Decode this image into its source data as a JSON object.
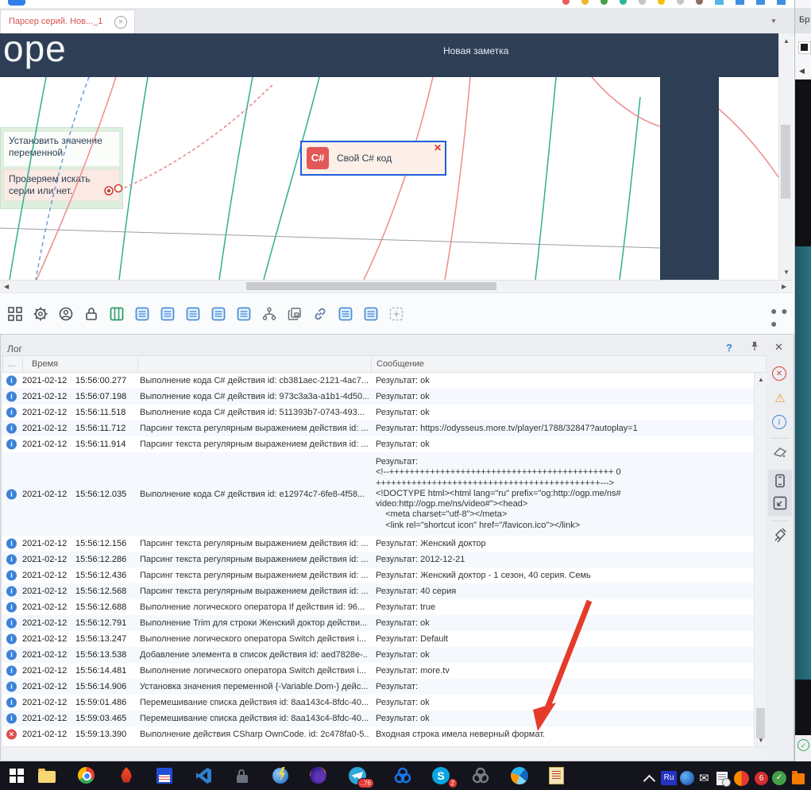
{
  "window": {
    "tab_title": "Парсер серий. Нов..._1",
    "big_text": "ope",
    "note_header": "Новая заметка",
    "side_title": "Бр",
    "toolbar_more": "..."
  },
  "blocks": {
    "set_variable": "Установить значение переменной",
    "check_series": "Проверяем искать серии или нет.",
    "cs_icon": "C#",
    "cs_label": "Свой C# код"
  },
  "log": {
    "title": "Лог",
    "help": "?",
    "col_dots": "...",
    "col_time": "Время",
    "col_message": "Сообщение",
    "rows": [
      {
        "icon": "info",
        "date": "2021-02-12",
        "time": "15:56:00.277",
        "action": "Выполнение кода C# действия id: cb381aec-2121-4ac7...",
        "message": "Результат: ok"
      },
      {
        "icon": "info",
        "date": "2021-02-12",
        "time": "15:56:07.198",
        "action": "Выполнение кода C# действия id: 973c3a3a-a1b1-4d50...",
        "message": "Результат: ok"
      },
      {
        "icon": "info",
        "date": "2021-02-12",
        "time": "15:56:11.518",
        "action": "Выполнение кода C# действия id: 511393b7-0743-493...",
        "message": "Результат: ok"
      },
      {
        "icon": "info",
        "date": "2021-02-12",
        "time": "15:56:11.712",
        "action": "Парсинг текста регулярным выражением действия id: ...",
        "message": "Результат: https://odysseus.more.tv/player/1788/32847?autoplay=1"
      },
      {
        "icon": "info",
        "date": "2021-02-12",
        "time": "15:56:11.914",
        "action": "Парсинг текста регулярным выражением действия id: ...",
        "message": "Результат: ok"
      },
      {
        "icon": "info",
        "date": "2021-02-12",
        "time": "15:56:12.035",
        "action": "Выполнение кода C# действия id: e12974c7-6fe8-4f58...",
        "message": "Результат:\n<!--++++++++++++++++++++++++++++++++++++++++++++ 0\n++++++++++++++++++++++++++++++++++++++++++++--->\n<!DOCTYPE html><html lang=\"ru\" prefix=\"og:http://ogp.me/ns#\nvideo:http://ogp.me/ns/video#\"><head>\n    <meta charset=\"utf-8\"></meta>\n    <link rel=\"shortcut icon\" href=\"/favicon.ico\"></link>"
      },
      {
        "icon": "info",
        "date": "2021-02-12",
        "time": "15:56:12.156",
        "action": "Парсинг текста регулярным выражением действия id: ...",
        "message": "Результат: Женский доктор"
      },
      {
        "icon": "info",
        "date": "2021-02-12",
        "time": "15:56:12.286",
        "action": "Парсинг текста регулярным выражением действия id: ...",
        "message": "Результат: 2012-12-21"
      },
      {
        "icon": "info",
        "date": "2021-02-12",
        "time": "15:56:12.436",
        "action": "Парсинг текста регулярным выражением действия id: ...",
        "message": "Результат: Женский доктор - 1 сезон, 40 серия. Семь"
      },
      {
        "icon": "info",
        "date": "2021-02-12",
        "time": "15:56:12.568",
        "action": "Парсинг текста регулярным выражением действия id: ...",
        "message": "Результат: 40 серия"
      },
      {
        "icon": "info",
        "date": "2021-02-12",
        "time": "15:56:12.688",
        "action": "Выполнение логического оператора If действия id: 96...",
        "message": "Результат: true"
      },
      {
        "icon": "info",
        "date": "2021-02-12",
        "time": "15:56:12.791",
        "action": "Выполнение Trim для строки Женский доктор действи...",
        "message": "Результат: ok"
      },
      {
        "icon": "info",
        "date": "2021-02-12",
        "time": "15:56:13.247",
        "action": "Выполнение логического оператора Switch действия i...",
        "message": "Результат: Default"
      },
      {
        "icon": "info",
        "date": "2021-02-12",
        "time": "15:56:13.538",
        "action": "Добавление элемента в список действия id: aed7828e-...",
        "message": "Результат: ok"
      },
      {
        "icon": "info",
        "date": "2021-02-12",
        "time": "15:56:14.481",
        "action": "Выполнение логического оператора Switch действия i...",
        "message": "Результат: more.tv"
      },
      {
        "icon": "info",
        "date": "2021-02-12",
        "time": "15:56:14.906",
        "action": "Установка значения переменной {-Variable.Dom-} дейс...",
        "message": "Результат:"
      },
      {
        "icon": "info",
        "date": "2021-02-12",
        "time": "15:59:01.486",
        "action": "Перемешивание списка действия id: 8aa143c4-8fdc-40...",
        "message": "Результат: ok"
      },
      {
        "icon": "info",
        "date": "2021-02-12",
        "time": "15:59:03.465",
        "action": "Перемешивание списка действия id: 8aa143c4-8fdc-40...",
        "message": "Результат: ok"
      },
      {
        "icon": "error",
        "date": "2021-02-12",
        "time": "15:59:13.390",
        "action": "Выполнение действия CSharp OwnCode. id: 2c478fa0-5...",
        "message": "Входная строка имела неверный формат."
      }
    ]
  },
  "taskbar": {
    "lang": "Ru",
    "telegram_badge": "..76",
    "skype_badge": "2",
    "red_badge": "6",
    "green_check": "✓"
  },
  "icons": {
    "log_filter_errors": "red-circle-x-icon",
    "log_filter_warnings": "warning-triangle-icon",
    "log_filter_info": "info-circle-icon",
    "toolbar": [
      "apps-grid",
      "gear",
      "profile",
      "lock",
      "table-green",
      "list-blue",
      "branch",
      "copy",
      "link",
      "capture-region"
    ]
  }
}
